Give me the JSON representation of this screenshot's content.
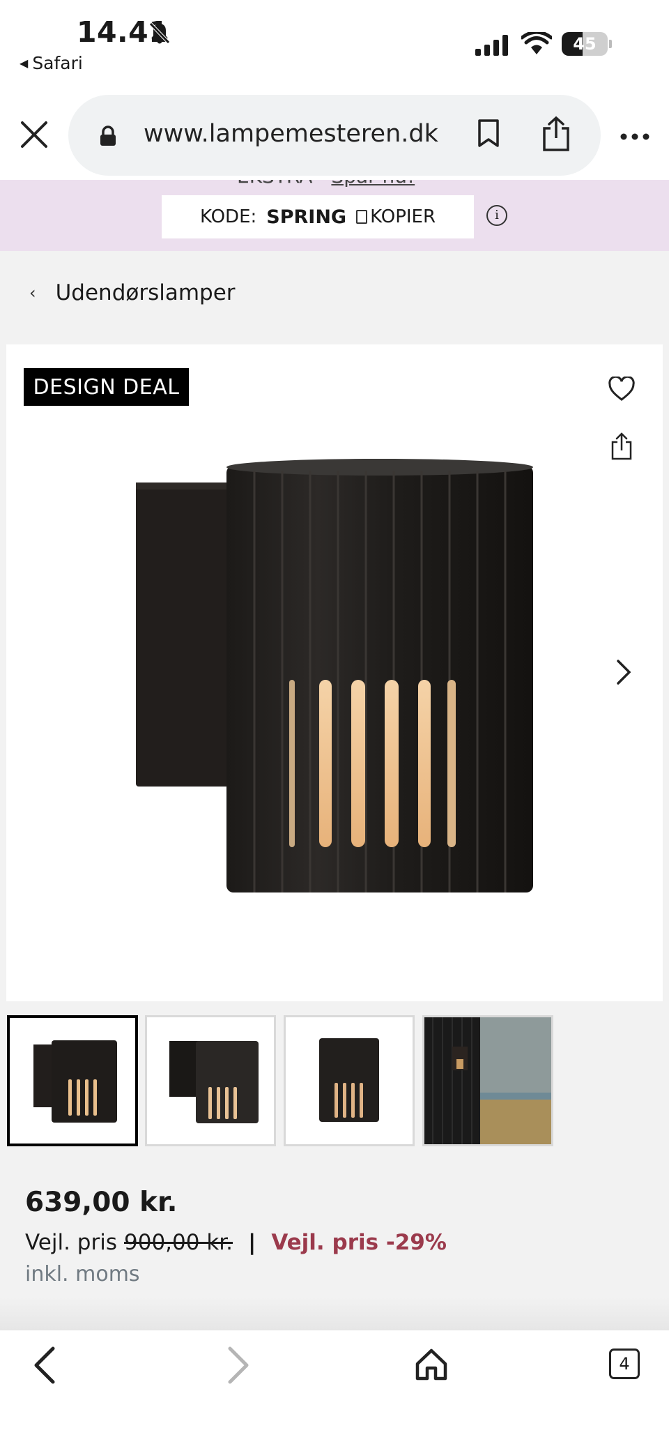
{
  "status_bar": {
    "time": "14.41",
    "back_app": "Safari",
    "battery": "45"
  },
  "browser": {
    "url": "www.lampemesteren.dk"
  },
  "promo": {
    "top_text": "EKSTRA -",
    "top_link": "Spar nu!",
    "code_label": "KODE:",
    "code_value": "SPRING",
    "copy_label": "KOPIER"
  },
  "breadcrumb": {
    "label": "Udendørslamper"
  },
  "product": {
    "badge": "DESIGN DEAL",
    "price": "639,00 kr.",
    "rrp_label": "Vejl. pris",
    "rrp_value": "900,00 kr.",
    "separator": "|",
    "discount": "Vejl. pris -29%",
    "tax_note": "inkl. moms"
  },
  "toolbar": {
    "tabs_count": "4"
  },
  "colors": {
    "promo_bg": "#ecdfee",
    "discount": "#9b3a4c",
    "page_bg": "#f2f2f2"
  }
}
